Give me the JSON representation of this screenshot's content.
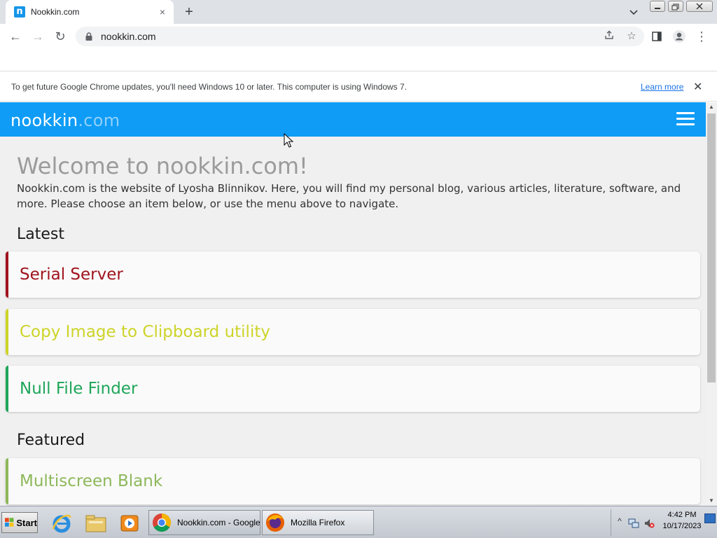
{
  "browser": {
    "tab": {
      "title": "Nookkin.com",
      "favicon_letter": "n",
      "close_icon": "×"
    },
    "new_tab_icon": "+",
    "tab_search_icon": "⌄",
    "window_controls": [
      "minimize-icon",
      "restore-icon",
      "close-icon"
    ],
    "toolbar": {
      "back_icon": "←",
      "forward_icon": "→",
      "reload_icon": "↻",
      "url": "nookkin.com",
      "share_icon": "share-icon",
      "bookmark_star_icon": "☆",
      "sidepanel_icon": "sidepanel-icon",
      "profile_icon": "profile-icon",
      "menu_icon": "⋮"
    },
    "infobar": {
      "message": "To get future Google Chrome updates, you'll need Windows 10 or later. This computer is using Windows 7.",
      "learn_more": "Learn more",
      "close_icon": "✕"
    }
  },
  "site": {
    "logo_name": "nookkin",
    "logo_tld": ".com",
    "welcome_title": "Welcome to nookkin.com!",
    "intro": "Nookkin.com is the website of Lyosha Blinnikov. Here, you will find my personal blog, various articles, literature, software, and more. Please choose an item below, or use the menu above to navigate.",
    "latest_heading": "Latest",
    "latest": [
      {
        "label": "Serial Server",
        "color": "#a0141e"
      },
      {
        "label": "Copy Image to Clipboard utility",
        "color": "#cdd428"
      },
      {
        "label": "Null File Finder",
        "color": "#1fa65a"
      }
    ],
    "featured_heading": "Featured",
    "featured": [
      {
        "label": "Multiscreen Blank",
        "color": "#8db85a"
      }
    ],
    "colors": {
      "header": "#0e9cf6",
      "page_bg": "#f0f0f0"
    }
  },
  "taskbar": {
    "start_label": "Start",
    "quick_launch": [
      "internet-explorer-icon",
      "windows-explorer-icon",
      "media-player-icon"
    ],
    "tasks": [
      {
        "label": "Nookkin.com - Google...",
        "icon": "chrome-icon",
        "active": true
      },
      {
        "label": "Mozilla Firefox",
        "icon": "firefox-icon",
        "active": false
      }
    ],
    "tray_expand_icon": "^",
    "clock_time": "4:42 PM",
    "clock_date": "10/17/2023"
  }
}
